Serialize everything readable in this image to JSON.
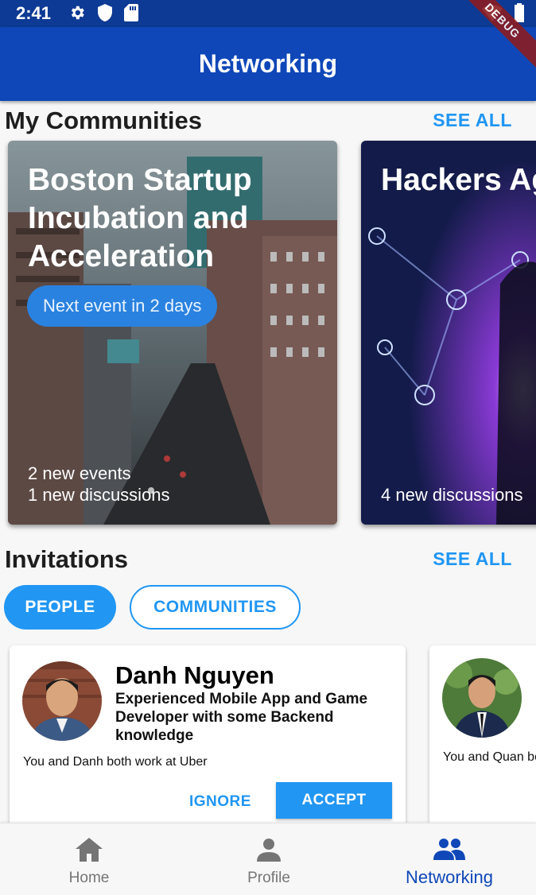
{
  "status_bar": {
    "time": "2:41",
    "icons_left": [
      "gear-icon",
      "shield-icon",
      "sd-card-icon"
    ],
    "icons_right": [
      "wifi-icon",
      "battery-icon"
    ]
  },
  "app_bar": {
    "title": "Networking",
    "debug_label": "DEBUG",
    "color": "#0f47b8"
  },
  "communities": {
    "heading": "My Communities",
    "see_all": "SEE ALL",
    "cards": [
      {
        "title": "Boston Startup Incubation and Acceleration",
        "pill": "Next event in 2 days",
        "footer_line1": "2 new events",
        "footer_line2": "1 new discussions"
      },
      {
        "title": "Hackers Ag",
        "footer_line1": "4 new discussions"
      }
    ]
  },
  "invitations": {
    "heading": "Invitations",
    "see_all": "SEE ALL",
    "tabs": [
      {
        "label": "PEOPLE",
        "selected": true
      },
      {
        "label": "COMMUNITIES",
        "selected": false
      }
    ],
    "cards": [
      {
        "name": "Danh Nguyen",
        "description": "Experienced Mobile App and Game Developer with some Backend knowledge",
        "mutual": "You and Danh both work at Uber",
        "ignore_label": "IGNORE",
        "accept_label": "ACCEPT"
      },
      {
        "mutual": "You and Quan bo"
      }
    ]
  },
  "bottom_nav": {
    "items": [
      {
        "label": "Home",
        "icon": "home-icon",
        "active": false
      },
      {
        "label": "Profile",
        "icon": "person-icon",
        "active": false
      },
      {
        "label": "Networking",
        "icon": "people-icon",
        "active": true
      }
    ]
  },
  "colors": {
    "primary": "#2196f3",
    "app_bar": "#0f47b8",
    "status_bar": "#0d3a94",
    "debug": "#8b1c22"
  }
}
